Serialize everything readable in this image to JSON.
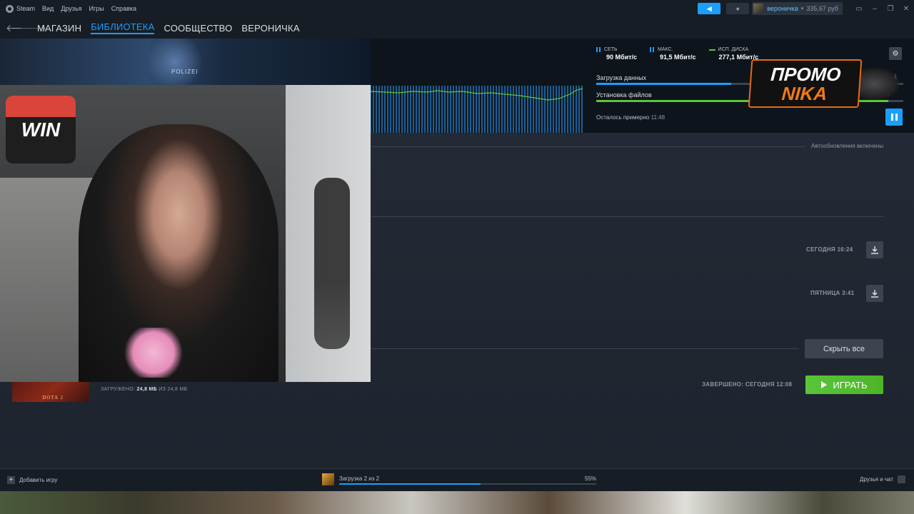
{
  "menubar": {
    "app_name": "Steam",
    "items": [
      "Вид",
      "Друзья",
      "Игры",
      "Справка"
    ],
    "user_name": "вероничка",
    "balance": "335,67 руб"
  },
  "nav": {
    "links": [
      "МАГАЗИН",
      "БИБЛИОТЕКА",
      "СООБЩЕСТВО",
      "ВЕРОНИЧКА"
    ],
    "active_index": 1
  },
  "banner": {
    "tag": "POLIZEI"
  },
  "stats": [
    {
      "label": "СЕТЬ",
      "value": "90 Мбит/с"
    },
    {
      "label": "МАКС.",
      "value": "91,5 Мбит/с"
    },
    {
      "label": "ИСП. ДИСКА",
      "value": "277,1 Мбит/с"
    }
  ],
  "progress": {
    "download_label": "Загрузка данных",
    "download_fraction": 0.44,
    "install_label": "Установка файлов",
    "install_fraction": 0.95,
    "install_pct_text": "%",
    "remaining_label": "Осталось примерно",
    "remaining_time": "11:48"
  },
  "promo": {
    "line1": "ПРОМО",
    "line2": "NIKA"
  },
  "main": {
    "auto_updates": "Автообновления включены",
    "scheduled": [
      {
        "time": "СЕГОДНЯ 16:24"
      },
      {
        "time": "ПЯТНИЦА 3:41"
      }
    ],
    "hide_all": "Скрыть все",
    "completed": "ЗАВЕРШЕНО: СЕГОДНЯ 12:08",
    "play": "ИГРАТЬ",
    "game_thumb_name": "DOTA 2",
    "downloaded_label": "ЗАГРУЖЕНО:",
    "downloaded_value": "24,8 МБ",
    "downloaded_of": "ИЗ 24,8 МБ"
  },
  "webcam": {
    "logo_text": "WIN"
  },
  "bottombar": {
    "add_game": "Добавить игру",
    "download_text": "Загрузка 2 из 2",
    "download_pct": "55%",
    "download_fraction": 0.55,
    "friends_chat": "Друзья и чат"
  },
  "colors": {
    "accent": "#1a9fff",
    "play_green": "#5ac53a",
    "promo_orange": "#e86a12"
  }
}
